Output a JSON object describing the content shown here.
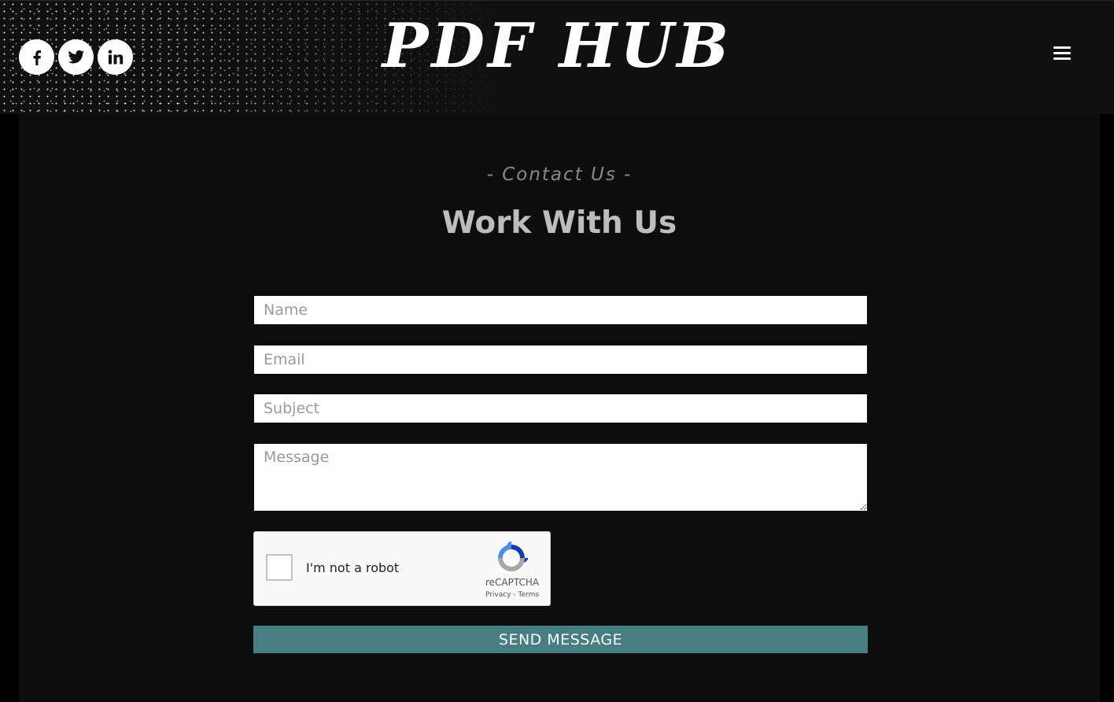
{
  "header": {
    "logo_text": "PDF HUB",
    "social": [
      {
        "name": "facebook",
        "icon": "facebook-icon"
      },
      {
        "name": "twitter",
        "icon": "twitter-icon"
      },
      {
        "name": "linkedin",
        "icon": "linkedin-icon"
      }
    ],
    "menu_icon": "hamburger-menu-icon"
  },
  "contact": {
    "overline": "-  Contact Us  -",
    "heading": "Work With Us",
    "fields": {
      "name_placeholder": "Name",
      "email_placeholder": "Email",
      "subject_placeholder": "Subject",
      "message_placeholder": "Message"
    },
    "captcha": {
      "label": "I'm not a robot",
      "brand": "reCAPTCHA",
      "privacy": "Privacy",
      "separator": " - ",
      "terms": "Terms"
    },
    "submit_label": "SEND MESSAGE"
  },
  "colors": {
    "header_bg": "#101010",
    "content_bg": "#0d0d0d",
    "button_bg": "#477e82",
    "heading_color": "#bdbdbd"
  }
}
